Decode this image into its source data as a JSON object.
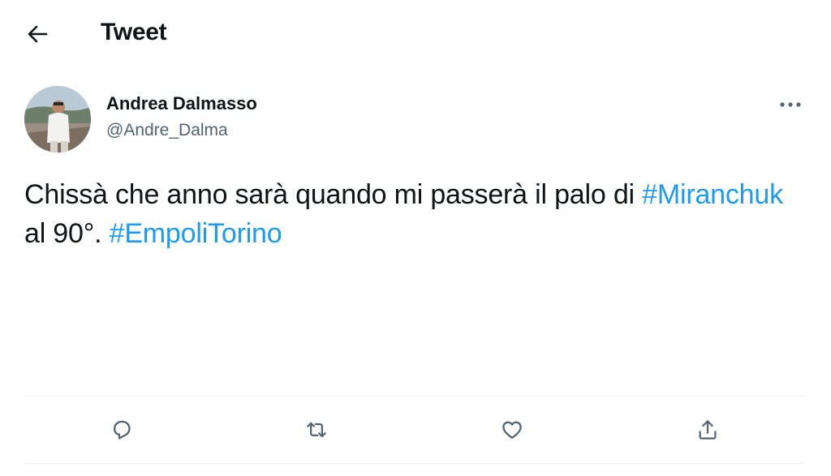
{
  "header": {
    "title": "Tweet",
    "back_icon": "arrow-left-icon"
  },
  "author": {
    "name": "Andrea Dalmasso",
    "handle": "@Andre_Dalma",
    "avatar_icon": "avatar-photo",
    "more_icon": "more-horizontal-icon"
  },
  "tweet": {
    "text_before": "Chissà che anno sarà quando mi passerà il palo di ",
    "hashtag_1": "#Miranchuk",
    "text_middle": " al 90°. ",
    "hashtag_2": "#EmpoliTorino"
  },
  "actions": [
    {
      "name": "reply",
      "icon": "reply-icon"
    },
    {
      "name": "retweet",
      "icon": "retweet-icon"
    },
    {
      "name": "like",
      "icon": "heart-icon"
    },
    {
      "name": "share",
      "icon": "share-icon"
    }
  ],
  "colors": {
    "text": "#0f1419",
    "secondary": "#536471",
    "accent": "#1d9bf0",
    "divider": "#eff3f4"
  }
}
